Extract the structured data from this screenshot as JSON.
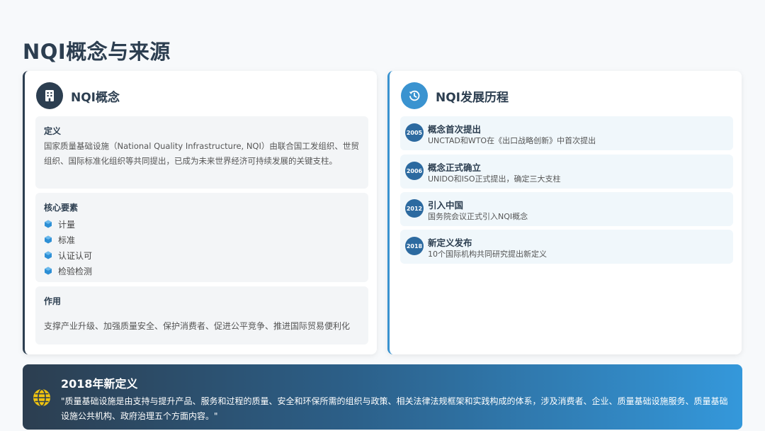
{
  "page": {
    "title": "NQI概念与来源"
  },
  "concept": {
    "title": "NQI概念",
    "icon": "building-icon",
    "definition": {
      "label": "定义",
      "text": "国家质量基础设施（National Quality Infrastructure, NQI）由联合国工发组织、世贸组织、国际标准化组织等共同提出，已成为未来世界经济可持续发展的关键支柱。"
    },
    "core": {
      "label": "核心要素",
      "items": [
        "计量",
        "标准",
        "认证认可",
        "检验检测"
      ]
    },
    "role": {
      "label": "作用",
      "text": "支撑产业升级、加强质量安全、保护消费者、促进公平竞争、推进国际贸易便利化"
    }
  },
  "history": {
    "title": "NQI发展历程",
    "icon": "history-icon",
    "items": [
      {
        "year": "2005",
        "title": "概念首次提出",
        "desc": "UNCTAD和WTO在《出口战略创新》中首次提出"
      },
      {
        "year": "2006",
        "title": "概念正式确立",
        "desc": "UNIDO和ISO正式提出，确定三大支柱"
      },
      {
        "year": "2012",
        "title": "引入中国",
        "desc": "国务院会议正式引入NQI概念"
      },
      {
        "year": "2018",
        "title": "新定义发布",
        "desc": "10个国际机构共同研究提出新定义"
      }
    ]
  },
  "banner": {
    "title": "2018年新定义",
    "icon": "globe-icon",
    "text": "\"质量基础设施是由支持与提升产品、服务和过程的质量、安全和环保所需的组织与政策、相关法律法规框架和实践构成的体系，涉及消费者、企业、质量基础设施服务、质量基础设施公共机构、政府治理五个方面内容。\""
  },
  "colors": {
    "dark": "#2c3e50",
    "accent": "#3a93d0",
    "badge": "#2c6aa0",
    "globe": "#f1c40f"
  }
}
